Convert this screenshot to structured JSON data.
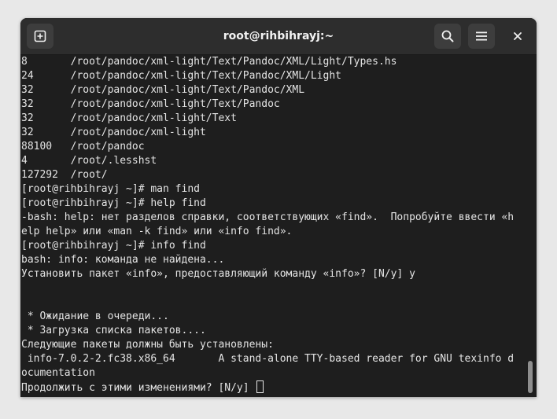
{
  "window": {
    "title": "root@rihbihrayj:~"
  },
  "header": {
    "new_tab_icon": "new-tab-icon",
    "search_icon": "search-icon",
    "menu_icon": "hamburger-menu-icon",
    "close_icon": "close-icon"
  },
  "terminal": {
    "lines": [
      "8       /root/pandoc/xml-light/Text/Pandoc/XML/Light/Types.hs",
      "24      /root/pandoc/xml-light/Text/Pandoc/XML/Light",
      "32      /root/pandoc/xml-light/Text/Pandoc/XML",
      "32      /root/pandoc/xml-light/Text/Pandoc",
      "32      /root/pandoc/xml-light/Text",
      "32      /root/pandoc/xml-light",
      "88100   /root/pandoc",
      "4       /root/.lesshst",
      "127292  /root/",
      "[root@rihbihrayj ~]# man find",
      "[root@rihbihrayj ~]# help find",
      "-bash: help: нет разделов справки, соответствующих «find».  Попробуйте ввести «h",
      "elp help» или «man -k find» или «info find».",
      "[root@rihbihrayj ~]# info find",
      "bash: info: команда не найдена...",
      "Установить пакет «info», предоставляющий команду «info»? [N/y] y",
      "",
      "",
      " * Ожидание в очереди...",
      " * Загрузка списка пакетов....",
      "Следующие пакеты должны быть установлены:",
      " info-7.0.2-2.fc38.x86_64       A stand-alone TTY-based reader for GNU texinfo d",
      "ocumentation"
    ],
    "prompt_line": "Продолжить с этими изменениями? [N/y] "
  }
}
